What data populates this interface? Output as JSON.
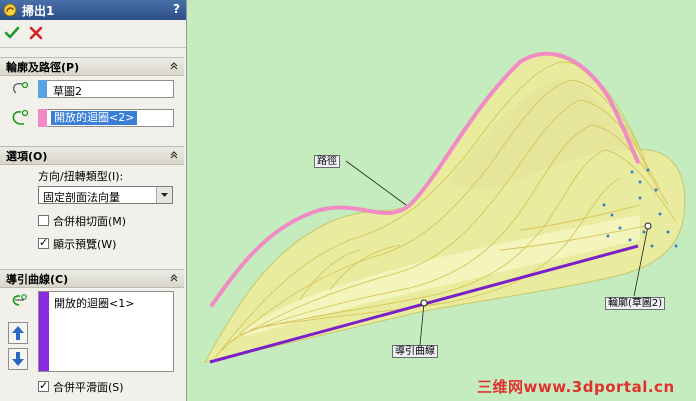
{
  "panel": {
    "title": "掃出1",
    "help": "?",
    "profile_path": {
      "header": "輪廓及路徑(P)",
      "profile_value": "草圖2",
      "path_value": "開放的迴圈<2>"
    },
    "options": {
      "header": "選項(O)",
      "orientation_label": "方向/扭轉類型(I):",
      "orientation_value": "固定剖面法向量",
      "merge_tangent_label": "合併相切面(M)",
      "merge_tangent_checked": false,
      "show_preview_label": "顯示預覽(W)",
      "show_preview_checked": true
    },
    "guide_curves": {
      "header": "導引曲線(C)",
      "items": [
        "開放的迴圈<1>"
      ],
      "merge_smooth_label": "合併平滑面(S)",
      "merge_smooth_checked": true
    }
  },
  "viewport": {
    "callouts": {
      "path": "路徑",
      "profile": "輪廓(草圖2)",
      "guide": "導引曲線"
    },
    "watermark": "三维网www.3dportal.cn"
  },
  "colors": {
    "viewport_bg": "#c5ecbe",
    "path_pink": "#f08bc4",
    "guide_purple": "#7b1fc9",
    "body_yellow": "#ecec9a",
    "selection_blue": "#3b7ed6"
  }
}
